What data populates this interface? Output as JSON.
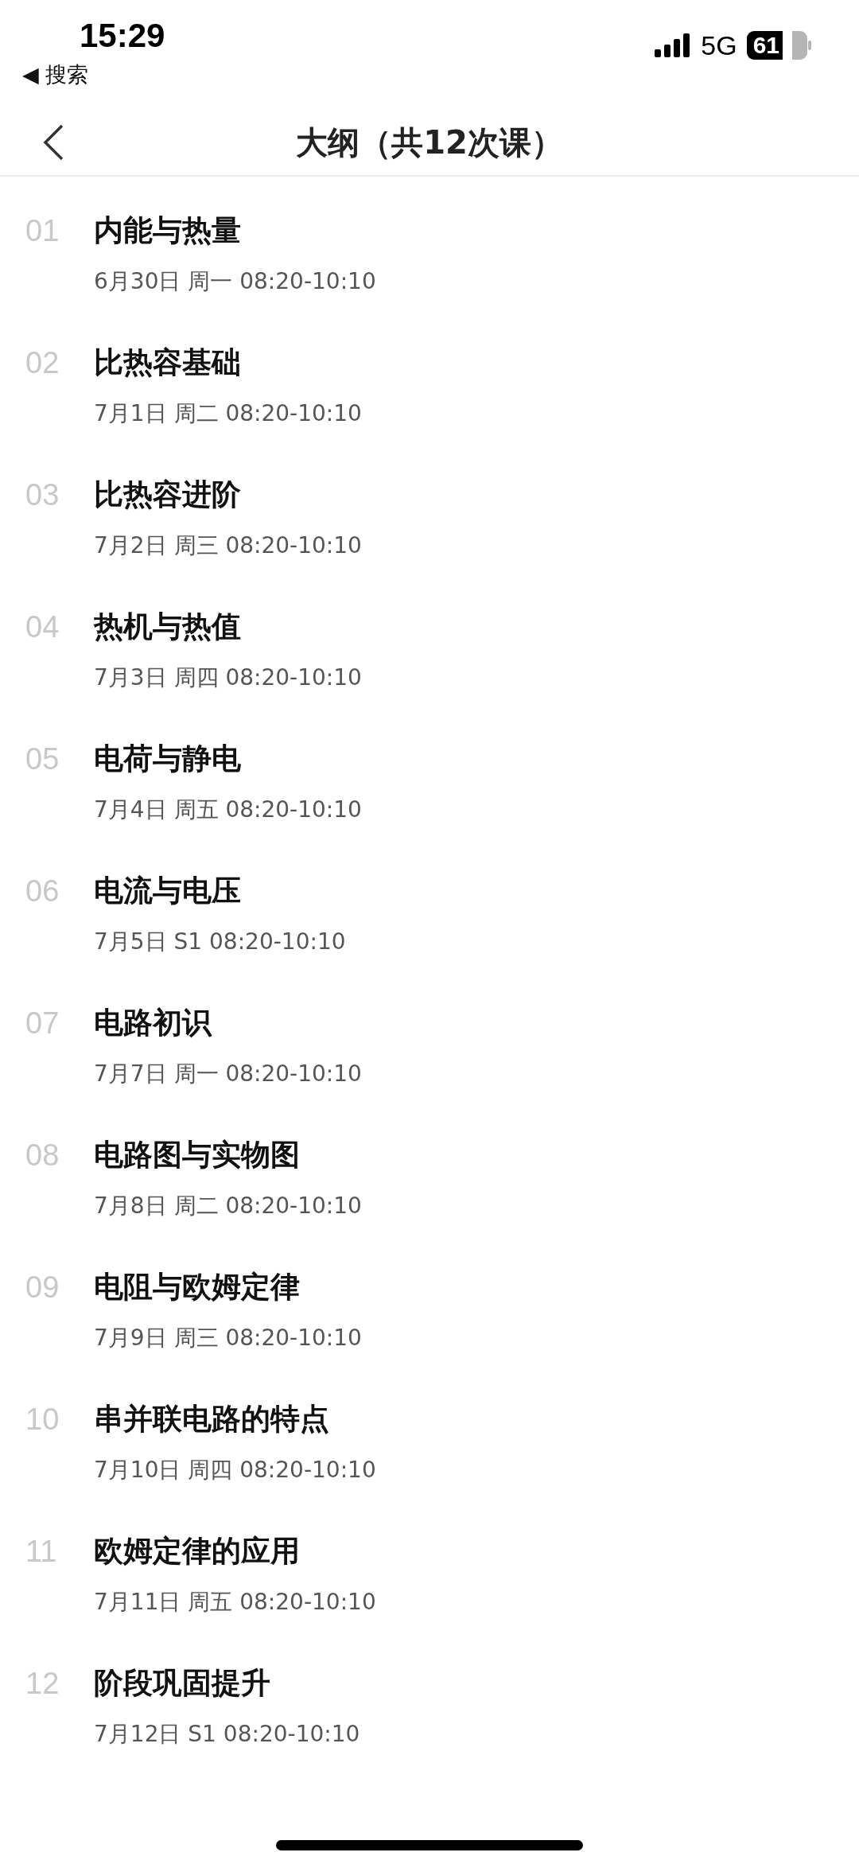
{
  "status_bar": {
    "time": "15:29",
    "back_label": "◀ 搜索",
    "network": "5G",
    "battery": "61"
  },
  "nav": {
    "title": "大纲（共12次课）"
  },
  "lessons": [
    {
      "number": "01",
      "title": "内能与热量",
      "schedule": "6月30日 周一 08:20-10:10"
    },
    {
      "number": "02",
      "title": "比热容基础",
      "schedule": "7月1日 周二 08:20-10:10"
    },
    {
      "number": "03",
      "title": "比热容进阶",
      "schedule": "7月2日 周三 08:20-10:10"
    },
    {
      "number": "04",
      "title": "热机与热值",
      "schedule": "7月3日 周四 08:20-10:10"
    },
    {
      "number": "05",
      "title": "电荷与静电",
      "schedule": "7月4日 周五 08:20-10:10"
    },
    {
      "number": "06",
      "title": "电流与电压",
      "schedule": "7月5日 S1 08:20-10:10"
    },
    {
      "number": "07",
      "title": "电路初识",
      "schedule": "7月7日 周一 08:20-10:10"
    },
    {
      "number": "08",
      "title": "电路图与实物图",
      "schedule": "7月8日 周二 08:20-10:10"
    },
    {
      "number": "09",
      "title": "电阻与欧姆定律",
      "schedule": "7月9日 周三 08:20-10:10"
    },
    {
      "number": "10",
      "title": "串并联电路的特点",
      "schedule": "7月10日 周四 08:20-10:10"
    },
    {
      "number": "11",
      "title": "欧姆定律的应用",
      "schedule": "7月11日 周五 08:20-10:10"
    },
    {
      "number": "12",
      "title": "阶段巩固提升",
      "schedule": "7月12日 S1 08:20-10:10"
    }
  ]
}
